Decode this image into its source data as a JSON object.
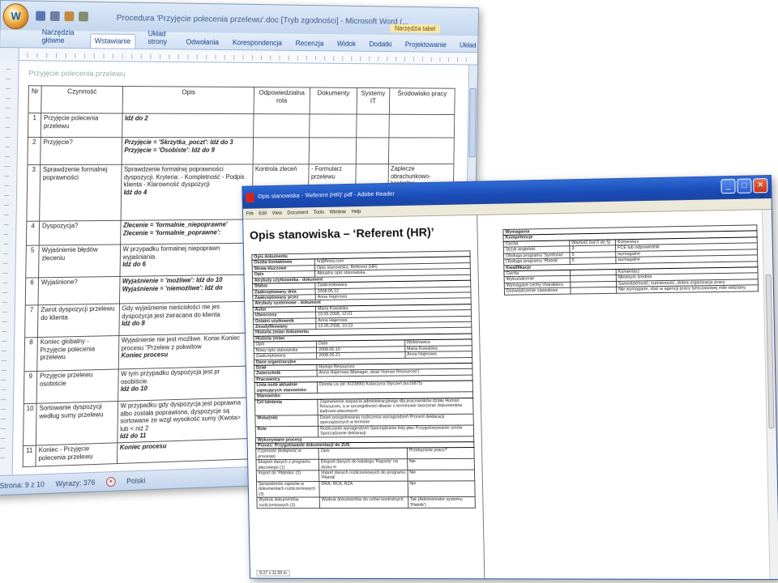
{
  "word": {
    "title": "Procedura 'Przyjęcie polecenia przelewu'.doc [Tryb zgodności] - Microsoft Word (...",
    "office_button_label": "W",
    "context_tab": "Narzędzia tabel",
    "ribbon_tabs": [
      "Narzędzia główne",
      "Wstawianie",
      "Układ strony",
      "Odwołania",
      "Korespondencja",
      "Recenzja",
      "Widok",
      "Dodatki",
      "Projektowanie",
      "Układ"
    ],
    "header_text": "Przyjęcie polecenia przelewu",
    "table_headers": [
      "Nr",
      "Czynność",
      "Opis",
      "Odpowiedzialna rola",
      "Dokumenty",
      "Systemy IT",
      "Środowisko pracy"
    ],
    "rows": [
      {
        "nr": "1",
        "czynnosc": "Przyjęcie polecenia przelewu",
        "opis": "",
        "opis_bold": "Idź do 2",
        "rola": "",
        "dok": "",
        "sys": "",
        "env": ""
      },
      {
        "nr": "2",
        "czynnosc": "Przyjęcie?",
        "opis": "",
        "opis_bold": "Przyjęcie = 'Skrzytka_poczt': Idź do 3 Przyjęcie = 'Osobiste': Idź do 9",
        "rola": "",
        "dok": "",
        "sys": "",
        "env": ""
      },
      {
        "nr": "3",
        "czynnosc": "Sprawdzenie formalnej poprawności",
        "opis": "Sprawdzenie formalnej poprawności dyspozycji. Kryteria: - Kompletność - Podpis klienta - Klarowność dyspozycji",
        "opis_bold": "Idź do 4",
        "rola": "Kontrola zleceń",
        "dok": "- Formularz przelewu",
        "sys": "",
        "env": "Zaplecze obrachunkowo-kontrolne"
      },
      {
        "nr": "4",
        "czynnosc": "Dyspozycja?",
        "opis": "",
        "opis_bold": "Zlecenie = 'formalnie_niepoprawne' Zlecenie = 'formalnie_poprawne':",
        "rola": "",
        "dok": "",
        "sys": "",
        "env": ""
      },
      {
        "nr": "5",
        "czynnosc": "Wyjaśnienie błędów zleceniu",
        "opis": "W przypadku formalnej niepoprawn wyjaśniania.",
        "opis_bold": "Idź do 6",
        "rola": "",
        "dok": "",
        "sys": "",
        "env": ""
      },
      {
        "nr": "6",
        "czynnosc": "Wyjaśnione?",
        "opis": "",
        "opis_bold": "Wyjaśnienie = 'możliwe': Idź do 10 Wyjaśnienie = 'niemożliwe': Idź do",
        "rola": "",
        "dok": "",
        "sys": "",
        "env": ""
      },
      {
        "nr": "7",
        "czynnosc": "Zwrot dyspozycji przelewu do klienta",
        "opis": "Gdy wyjaśnienie nieścisłości nie jes dyspozycja jest zwracana do klienta",
        "opis_bold": "Idź do 8",
        "rola": "",
        "dok": "",
        "sys": "",
        "env": ""
      },
      {
        "nr": "8",
        "czynnosc": "Koniec globalny - Przyjęcie polecenia przelewu",
        "opis": "Wyjaśnienie nie jest możliwe. Konie Koniec procesu \"Przelew z pokwitow",
        "opis_bold": "Koniec procesu",
        "rola": "",
        "dok": "",
        "sys": "",
        "env": ""
      },
      {
        "nr": "9",
        "czynnosc": "Przyjęcie przelewu osobiście",
        "opis": "W tym przypadku dyspozycja jest pr osobiście.",
        "opis_bold": "Idź do 10",
        "rola": "",
        "dok": "",
        "sys": "",
        "env": ""
      },
      {
        "nr": "10",
        "czynnosc": "Sortowanie dyspozycji według sumy przelewu",
        "opis": "W przypadku gdy dyspozycja jest poprawna albo została poprawiona, dyspozycje są sortowane ze wzgl wysokość sumy (Kwota> lub < niż 2",
        "opis_bold": "Idź do 11",
        "rola": "",
        "dok": "",
        "sys": "",
        "env": ""
      },
      {
        "nr": "11",
        "czynnosc": "Koniec - Przyjęcie polecenia przelewu",
        "opis": "",
        "opis_bold": "Koniec procesu",
        "rola": "",
        "dok": "",
        "sys": "",
        "env": ""
      }
    ],
    "status": {
      "page": "Strona: 9 z 10",
      "words": "Wyrazy: 376",
      "language": "Polski"
    }
  },
  "reader": {
    "title": "Opis stanowiska - 'Referent (HR)'.pdf - Adobe Reader",
    "menu": [
      "File",
      "Edit",
      "View",
      "Document",
      "Tools",
      "Window",
      "Help"
    ],
    "heading": "Opis stanowiska – ‘Referent (HR)’",
    "left_table": [
      {
        "sec": "Opis dokumentu"
      },
      {
        "c": [
          "Osoba kontaktowa",
          "hr@firma.com"
        ]
      },
      {
        "c": [
          "Słowa kluczowe",
          "Opis stanowiska, Referent (HR)"
        ]
      },
      {
        "c": [
          "Opis",
          "Aktualny opis stanowiska."
        ]
      },
      {
        "sec": "Atrybuty użytkownika - dokument"
      },
      {
        "c": [
          "Status",
          "Zaakceptowany"
        ]
      },
      {
        "c": [
          "Zaakceptowany dnia",
          "2008.05.12"
        ]
      },
      {
        "c": [
          "Zaakceptowany przez",
          "Anna Hajerowa"
        ]
      },
      {
        "sec": "Atrybuty systemowe - dokument"
      },
      {
        "c": [
          "Autor",
          "Maria Kowalska"
        ]
      },
      {
        "c": [
          "Utworzony",
          "10.05.2008, 12:01"
        ]
      },
      {
        "c": [
          "Ostatni użytkownik",
          "Anna Hajerowa"
        ]
      },
      {
        "c": [
          "Zmodyfikowany",
          "12.05.2008, 10:23"
        ]
      },
      {
        "sec": "Historia zmian dokumentu"
      },
      {
        "sec": "Historia zmian"
      },
      {
        "h": [
          "Opis",
          "Data",
          "Wykonawca"
        ]
      },
      {
        "c": [
          "Nowy opis stanowiska",
          "2008.05.10",
          "Maria Kowalska"
        ]
      },
      {
        "c": [
          "Zaakceptowany",
          "2008.05.21",
          "Anna Hajerowa"
        ]
      },
      {
        "sec": "Dane organizacyjne"
      },
      {
        "c": [
          "Dział",
          "Human Resources"
        ]
      },
      {
        "c": [
          "Zwierzchnik",
          "Anna Hajerowa (Manager, dział 'Human Resources')"
        ]
      },
      {
        "sec": "Pracownicy"
      },
      {
        "c": [
          "Lista osób aktualnie zajmujących stanowisko",
          "Dorota Lis (id: KI23890) Katarzyna Styczeń (ks15875)"
        ]
      },
      {
        "sec": "Stanowisko"
      },
      {
        "c": [
          "Cel istnienia",
          "Zapewnienie wsparcia administracyjnego dla pracowników działu Human Resources, a w szczególności dbanie o terminowe tworzenie dokumentów kadrowo-płacowych."
        ]
      },
      {
        "c": [
          "Wskaźniki",
          "Dzień przygotowania rozliczenia wynagrodzeń Procent deklaracji sporządzonych w terminie"
        ]
      },
      {
        "c": [
          "Role",
          "Rozliczanie wynagrodzeń Sporządzanie listy płac Przygotowywanie umów Sporządzanie deklaracji"
        ]
      },
      {
        "sec": "Wykonywane procesy"
      },
      {
        "sec": "Proces: Przygotowanie dokumentacji do ZUS"
      },
      {
        "h": [
          "Czynność (kolejność w procesie)",
          "Opis",
          "Przekazanie pracy?"
        ]
      },
      {
        "c": [
          "Eksport danych z programu płacowego (1)",
          "Eksport danych do katalogu 'Raporty' na dysku H",
          "Nie"
        ]
      },
      {
        "c": [
          "Import do 'Płatnika' (2)",
          "Import danych rozliczeniowych do programu 'Płatnik'",
          "Nie"
        ]
      },
      {
        "c": [
          "Sprawdzenie zapisów w dokumentach rozliczeniowych (3)",
          "DRA, RCA, RZA",
          "Nie"
        ]
      },
      {
        "c": [
          "Wydruk dokumentów rozliczeniowych (3)",
          "Wydruk dokumentów do celów kontrolnych",
          "Tak (Administrator systemu 'Płatnik')"
        ]
      }
    ],
    "right_table": [
      {
        "sec": "Wymagania"
      },
      {
        "sec": "Kompetencje"
      },
      {
        "h": [
          "Cecha",
          "Wartość (od 0 do 5)",
          "Komentarz"
        ]
      },
      {
        "c": [
          "Język angielski",
          "3",
          "FCE lub odpowiednik"
        ]
      },
      {
        "c": [
          "Obsługa programu 'Symfonia'",
          "5",
          "wymagalne"
        ]
      },
      {
        "c": [
          "Obsługa programu 'Płatnik'",
          "5",
          "wymagalne"
        ]
      },
      {
        "sec": "Kwalifikacje"
      },
      {
        "h": [
          "Cecha",
          "",
          "Komentarz"
        ]
      },
      {
        "c": [
          "Wykształcenie",
          "",
          "Minimum średnie"
        ]
      },
      {
        "c": [
          "Wymagane cechy charakteru",
          "",
          "Samodzielność, sumienność, dobra organizacja pracy"
        ]
      },
      {
        "c": [
          "Doświadczenie zawodowe",
          "",
          "Nie wymagane, staż w agencji pracy tymczasowej mile widziany."
        ]
      }
    ],
    "page_size": "8,27 x 11,69 in"
  }
}
